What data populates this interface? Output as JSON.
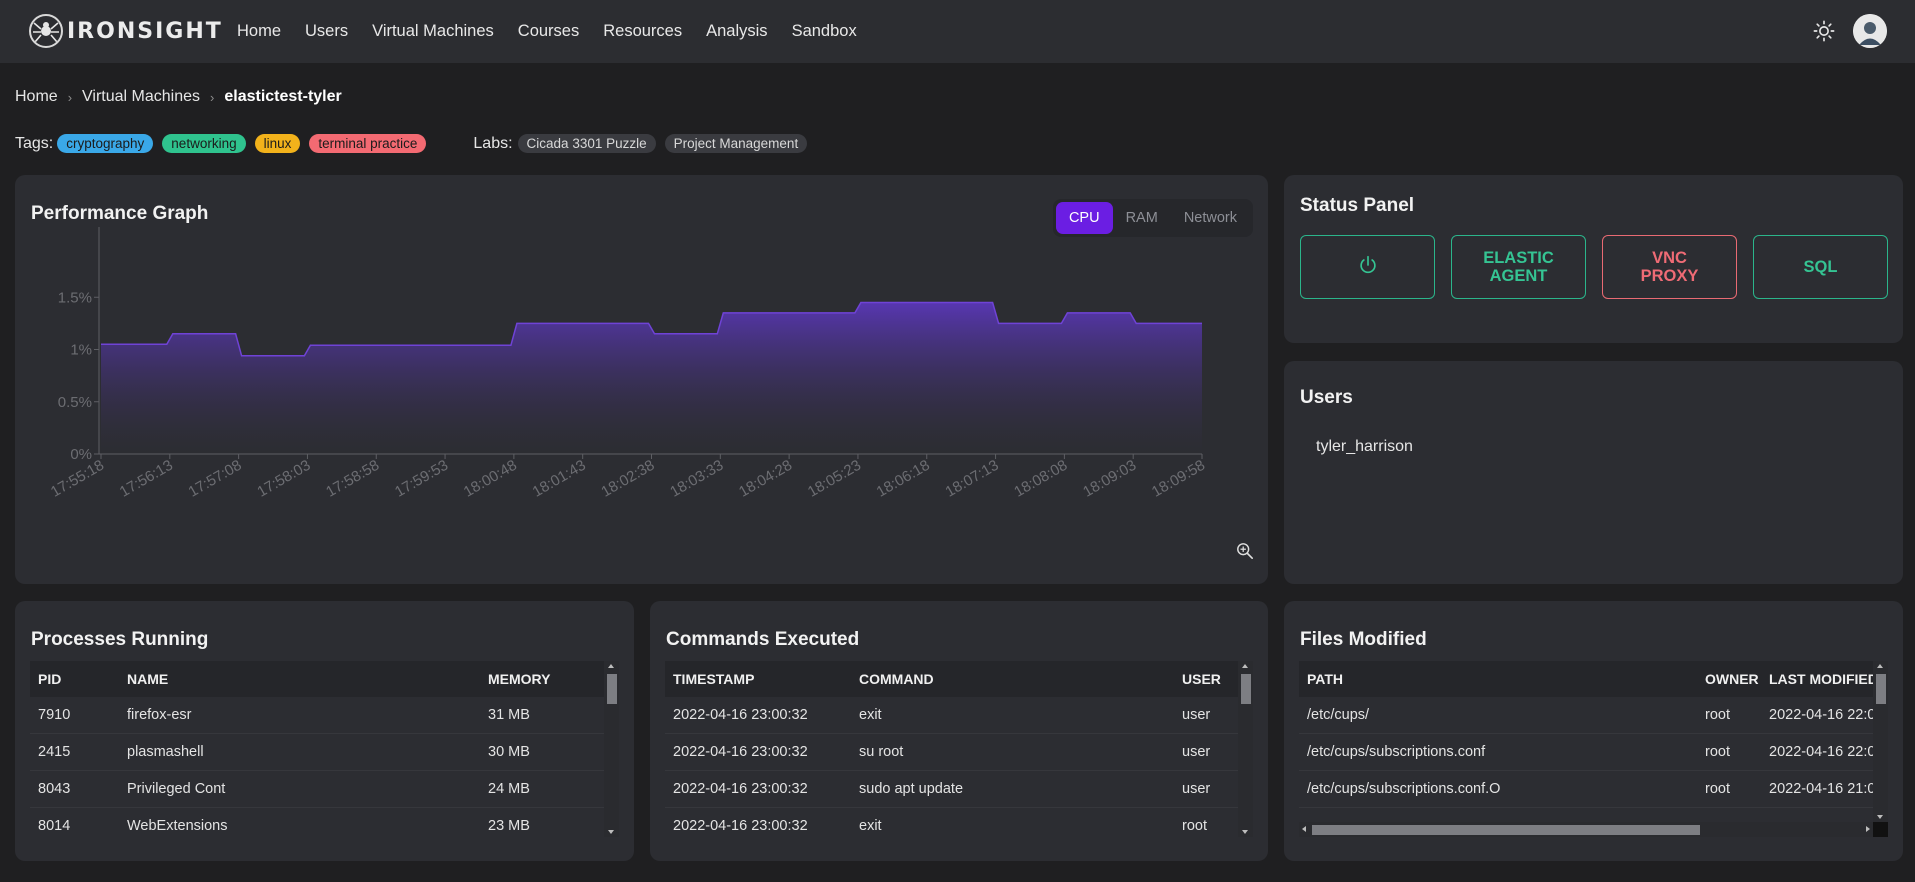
{
  "app": {
    "logo_text": "IRONSIGHT"
  },
  "nav": {
    "links": [
      "Home",
      "Users",
      "Virtual Machines",
      "Courses",
      "Resources",
      "Analysis",
      "Sandbox"
    ]
  },
  "breadcrumb": [
    "Home",
    "Virtual Machines",
    "elastictest-tyler"
  ],
  "tags": {
    "label": "Tags:",
    "items": [
      {
        "text": "cryptography",
        "color": "#3aa8e8"
      },
      {
        "text": "networking",
        "color": "#2fc38e"
      },
      {
        "text": "linux",
        "color": "#f2b21b"
      },
      {
        "text": "terminal practice",
        "color": "#f36a72"
      }
    ]
  },
  "labs": {
    "label": "Labs:",
    "items": [
      "Cicada 3301 Puzzle",
      "Project Management"
    ]
  },
  "performance": {
    "title": "Performance Graph",
    "tabs": [
      "CPU",
      "RAM",
      "Network"
    ],
    "active_tab": "CPU"
  },
  "chart_data": {
    "type": "area",
    "x": [
      "17:55:18",
      "17:56:13",
      "17:57:08",
      "17:58:03",
      "17:58:58",
      "17:59:53",
      "18:00:48",
      "18:01:43",
      "18:02:38",
      "18:03:33",
      "18:04:28",
      "18:05:23",
      "18:06:18",
      "18:07:13",
      "18:08:08",
      "18:09:03",
      "18:09:58"
    ],
    "steps": [
      {
        "from": "17:55:18",
        "to": "17:56:13",
        "value": 1.05
      },
      {
        "from": "17:56:13",
        "to": "17:57:08",
        "value": 1.15
      },
      {
        "from": "17:57:08",
        "to": "17:58:03",
        "value": 0.94
      },
      {
        "from": "17:58:03",
        "to": "18:00:48",
        "value": 1.04
      },
      {
        "from": "18:00:48",
        "to": "18:02:38",
        "value": 1.25
      },
      {
        "from": "18:02:38",
        "to": "18:03:33",
        "value": 1.15
      },
      {
        "from": "18:03:33",
        "to": "18:05:23",
        "value": 1.35
      },
      {
        "from": "18:05:23",
        "to": "18:07:13",
        "value": 1.45
      },
      {
        "from": "18:07:13",
        "to": "18:08:08",
        "value": 1.25
      },
      {
        "from": "18:08:08",
        "to": "18:09:03",
        "value": 1.35
      },
      {
        "from": "18:09:03",
        "to": "18:09:58",
        "value": 1.25
      }
    ],
    "yticks": [
      "0%",
      "0.5%",
      "1%",
      "1.5%"
    ],
    "ylim": [
      0,
      2
    ],
    "xlabel": "",
    "ylabel": "",
    "grid": false,
    "colors": {
      "line": "#6f43d6",
      "fill_top": "#5a37b8",
      "fill_bottom": "#2c2d32"
    }
  },
  "status_panel": {
    "title": "Status Panel",
    "buttons": [
      {
        "label": "",
        "icon": "power-icon",
        "color": "#2bb58b"
      },
      {
        "label": "ELASTIC AGENT",
        "color": "#2bb58b"
      },
      {
        "label": "VNC PROXY",
        "color": "#e96a73"
      },
      {
        "label": "SQL",
        "color": "#2bb58b"
      }
    ]
  },
  "users": {
    "title": "Users",
    "items": [
      "tyler_harrison"
    ]
  },
  "processes": {
    "title": "Processes Running",
    "columns": [
      "PID",
      "NAME",
      "MEMORY"
    ],
    "rows": [
      [
        "7910",
        "firefox-esr",
        "31 MB"
      ],
      [
        "2415",
        "plasmashell",
        "30 MB"
      ],
      [
        "8043",
        "Privileged Cont",
        "24 MB"
      ],
      [
        "8014",
        "WebExtensions",
        "23 MB"
      ]
    ]
  },
  "commands": {
    "title": "Commands Executed",
    "columns": [
      "TIMESTAMP",
      "COMMAND",
      "USER"
    ],
    "rows": [
      [
        "2022-04-16 23:00:32",
        "exit",
        "user"
      ],
      [
        "2022-04-16 23:00:32",
        "su root",
        "user"
      ],
      [
        "2022-04-16 23:00:32",
        "sudo apt update",
        "user"
      ],
      [
        "2022-04-16 23:00:32",
        "exit",
        "root"
      ]
    ]
  },
  "files": {
    "title": "Files Modified",
    "columns": [
      "PATH",
      "OWNER",
      "LAST MODIFIED"
    ],
    "rows": [
      [
        "/etc/cups/",
        "root",
        "2022-04-16 22:0"
      ],
      [
        "/etc/cups/subscriptions.conf",
        "root",
        "2022-04-16 22:0"
      ],
      [
        "/etc/cups/subscriptions.conf.O",
        "root",
        "2022-04-16 21:0"
      ]
    ]
  }
}
